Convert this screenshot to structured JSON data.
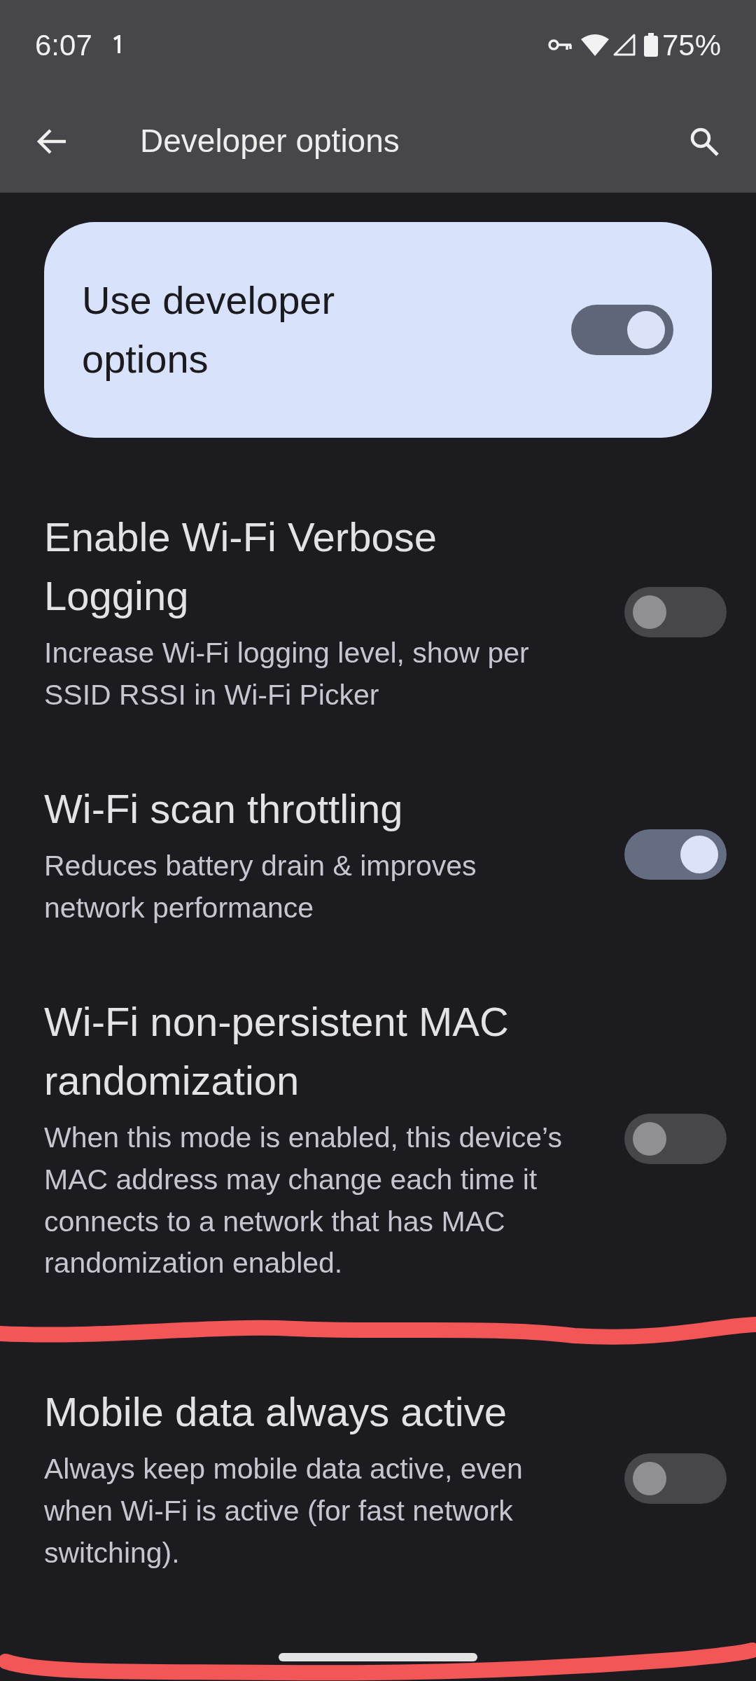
{
  "status_bar": {
    "time": "6:07",
    "battery": "75%"
  },
  "app_bar": {
    "title": "Developer options"
  },
  "main_switch": {
    "label": "Use developer options",
    "on": true
  },
  "settings": [
    {
      "title": "Enable Wi-Fi Verbose Logging",
      "summary": "Increase Wi-Fi logging level, show per SSID RSSI in Wi-Fi Picker",
      "on": false
    },
    {
      "title": "Wi-Fi scan throttling",
      "summary": "Reduces battery drain & improves network performance",
      "on": true
    },
    {
      "title": "Wi-Fi non-persistent MAC randomization",
      "summary": "When this mode is enabled, this device’s MAC address may change each time it connects to a network that has MAC randomization enabled.",
      "on": false
    },
    {
      "title": "Mobile data always active",
      "summary": "Always keep mobile data active, even when Wi-Fi is active (for fast network switching).",
      "on": false
    }
  ]
}
